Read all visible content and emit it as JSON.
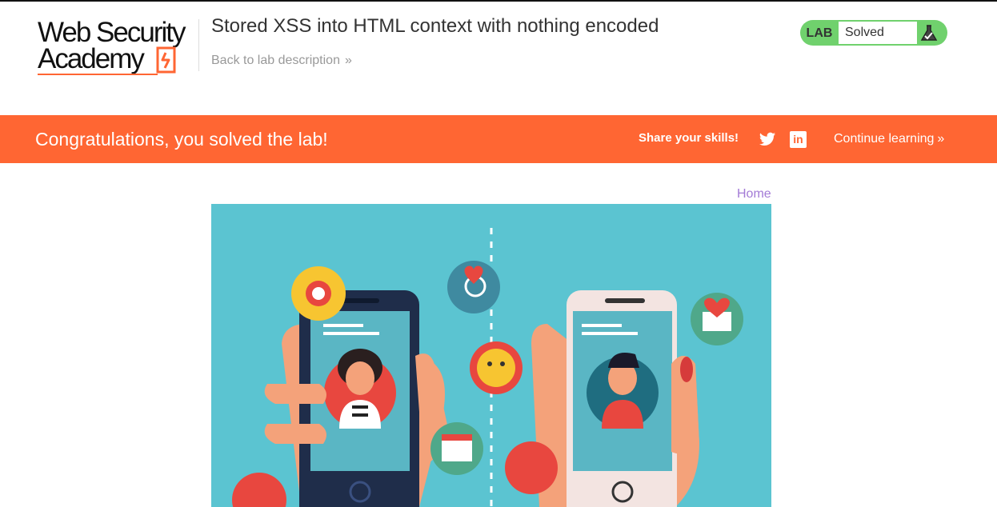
{
  "header": {
    "logo_line1": "Web Security",
    "logo_line2": "Academy",
    "title": "Stored XSS into HTML context with nothing encoded",
    "back_link": "Back to lab description",
    "back_chevron": "»",
    "status_tag": "LAB",
    "status_value": "Solved"
  },
  "banner": {
    "message": "Congratulations, you solved the lab!",
    "share_label": "Share your skills!",
    "linkedin_glyph": "in",
    "continue_label": "Continue learning",
    "continue_chevron": "»"
  },
  "nav": {
    "home_link": "Home"
  },
  "colors": {
    "accent": "#ff6633",
    "solved_green": "#70d16d",
    "link_purple": "#a37bd6",
    "hero_bg": "#5bc4d1"
  },
  "icons": [
    "academy-bolt-icon",
    "flask-icon",
    "twitter-icon",
    "linkedin-icon"
  ]
}
